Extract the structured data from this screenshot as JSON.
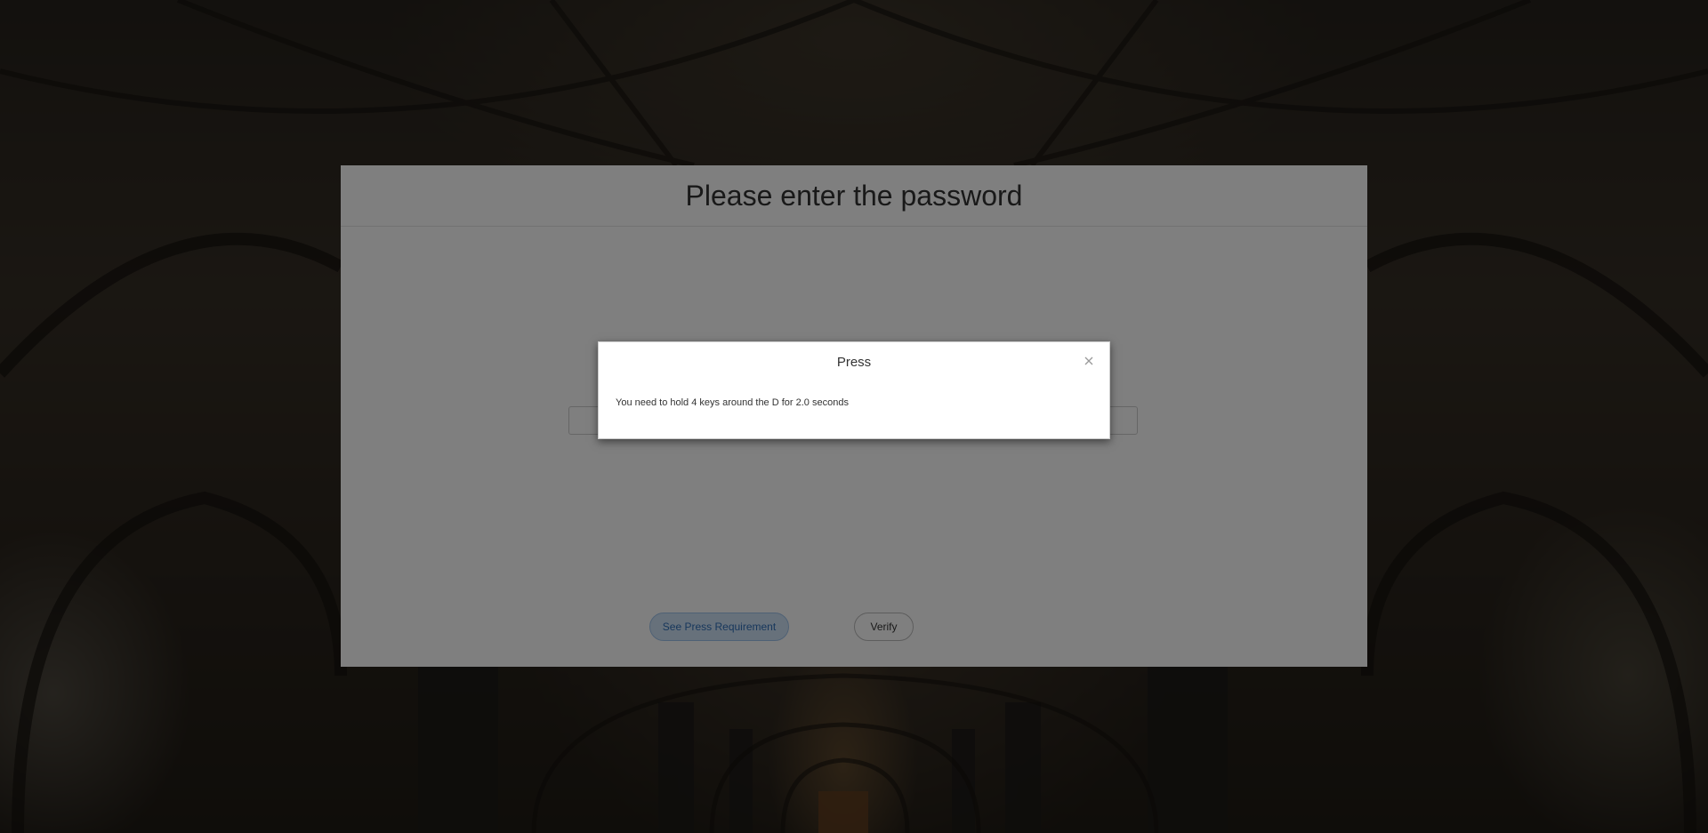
{
  "page": {
    "title": "Please enter the password"
  },
  "password_input": {
    "value": "",
    "placeholder": ""
  },
  "buttons": {
    "see_requirement": "See Press Requirement",
    "verify": "Verify"
  },
  "modal": {
    "title": "Press",
    "message": "You need to hold 4 keys around the D for 2.0 seconds",
    "close_icon": "close-icon"
  },
  "colors": {
    "primary_button_bg": "#cfe2f7",
    "primary_button_text": "#2f6fb8",
    "overlay": "rgba(0,0,0,0.5)"
  }
}
